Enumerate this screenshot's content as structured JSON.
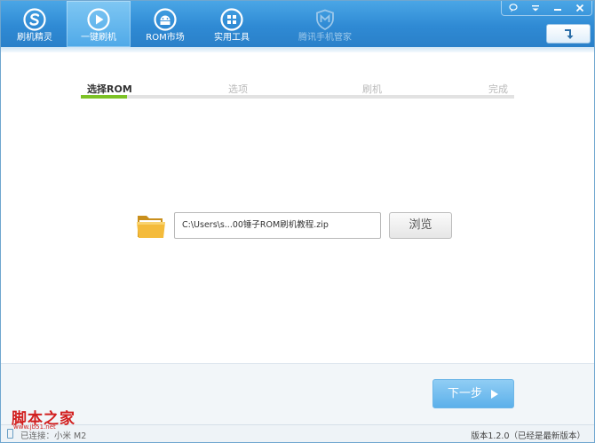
{
  "nav": {
    "tabs": [
      {
        "label": "刷机精灵",
        "icon": "s-logo-icon",
        "state": "normal"
      },
      {
        "label": "一键刷机",
        "icon": "play-icon",
        "state": "active"
      },
      {
        "label": "ROM市场",
        "icon": "android-icon",
        "state": "normal"
      },
      {
        "label": "实用工具",
        "icon": "grid-icon",
        "state": "normal"
      },
      {
        "label": "腾讯手机管家",
        "icon": "shield-icon",
        "state": "disabled"
      }
    ]
  },
  "window_controls": {
    "feedback": "feedback-icon",
    "menu": "menu-icon",
    "minimize": "minimize-icon",
    "close": "close-icon",
    "refresh": "refresh-icon"
  },
  "steps": {
    "items": [
      "选择ROM",
      "选项",
      "刷机",
      "完成"
    ],
    "current": 0,
    "progress_color": "#7cc225"
  },
  "file": {
    "path": "C:\\Users\\s...00锤子ROM刷机教程.zip",
    "browse_label": "浏览"
  },
  "actions": {
    "next_label": "下一步"
  },
  "status": {
    "connection": "已连接：小米 M2",
    "version": "版本1.2.0（已经是最新版本）"
  },
  "watermark": {
    "cn": "脚本之家",
    "url": "www.jb51.net"
  },
  "colors": {
    "titlebar": "#2f8ad4",
    "active_tab": "#7fc7f3",
    "next_button": "#5cb0ea"
  }
}
